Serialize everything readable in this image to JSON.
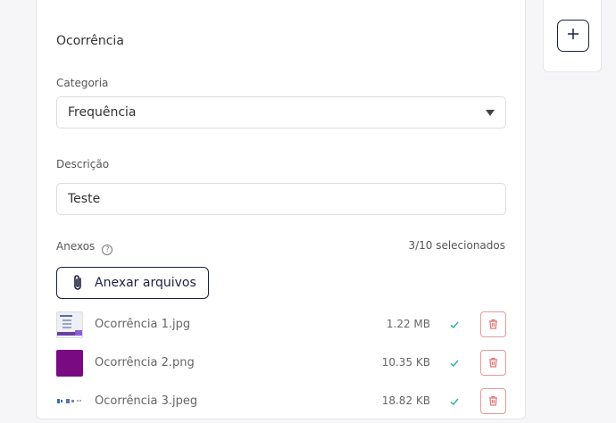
{
  "form": {
    "section_title": "Ocorrência",
    "category_label": "Categoria",
    "category_value": "Frequência",
    "description_label": "Descrição",
    "description_value": "Teste",
    "attachments_label": "Anexos",
    "attachments_help": "?",
    "attachments_counter": "3/10 selecionados",
    "attach_button_label": "Anexar arquivos"
  },
  "files": [
    {
      "name": "Ocorrência 1.jpg",
      "size": "1.22 MB",
      "thumb": "screenshot"
    },
    {
      "name": "Ocorrência 2.png",
      "size": "10.35 KB",
      "thumb": "purple"
    },
    {
      "name": "Ocorrência 3.jpeg",
      "size": "18.82 KB",
      "thumb": "icons"
    }
  ],
  "colors": {
    "accent": "#1d2340",
    "success": "#2bb3a0",
    "danger": "#e57373",
    "thumb_purple": "#7a0a82"
  },
  "icons": {
    "add": "plus-icon",
    "dropdown": "caret-down-icon",
    "help": "question-circle-icon",
    "attach": "paperclip-icon",
    "done": "check-icon",
    "delete": "trash-icon"
  }
}
